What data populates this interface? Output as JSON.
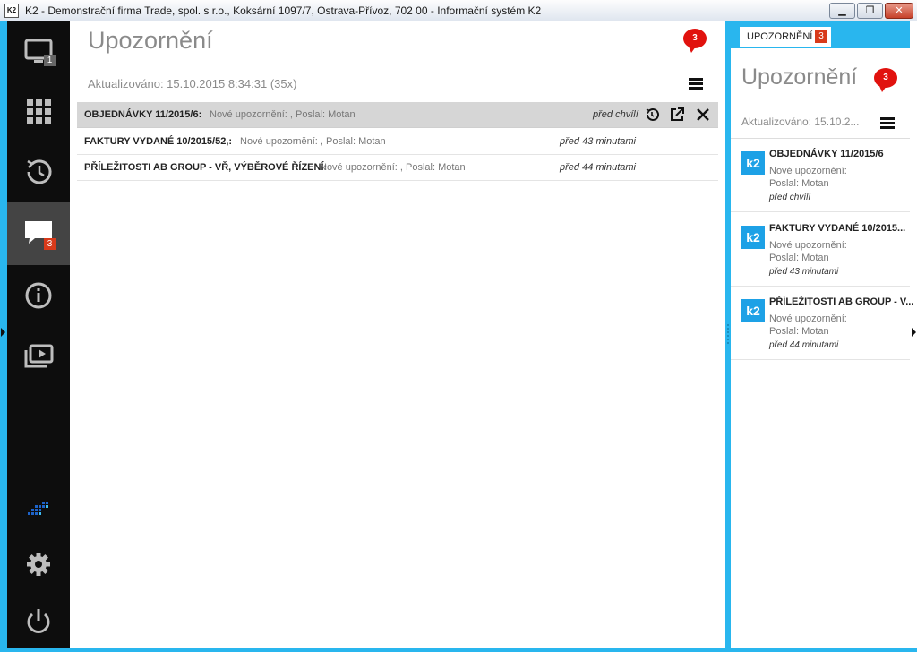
{
  "window": {
    "title": "K2 - Demonstrační firma Trade, spol. s r.o., Koksární 1097/7, Ostrava-Přívoz, 702 00 - Informační systém K2",
    "app_icon_label": "K2",
    "minimize": "▁",
    "maximize": "❐",
    "close": "✕"
  },
  "sidebar": {
    "items": [
      {
        "icon": "monitor-icon",
        "badge": "1"
      },
      {
        "icon": "apps-grid-icon",
        "badge": ""
      },
      {
        "icon": "history-icon",
        "badge": ""
      },
      {
        "icon": "notifications-icon",
        "badge": "3",
        "active": true
      },
      {
        "icon": "info-icon",
        "badge": ""
      },
      {
        "icon": "media-library-icon",
        "badge": ""
      }
    ],
    "bottom": [
      "k2-brand-icon",
      "settings-icon",
      "power-icon"
    ]
  },
  "main": {
    "title": "Upozornění",
    "badge": "3",
    "updated": "Aktualizováno: 15.10.2015 8:34:31 (35x)",
    "rows": [
      {
        "subject": "OBJEDNÁVKY 11/2015/6:",
        "desc": "Nové upozornění: , Poslal: Motan",
        "time": "před chvílí"
      },
      {
        "subject": "FAKTURY VYDANÉ 10/2015/52,:",
        "desc": "Nové upozornění: , Poslal: Motan",
        "time": "před 43 minutami"
      },
      {
        "subject": "PŘÍLEŽITOSTI AB GROUP - VŘ, VÝBĚROVÉ ŘÍZENÍ:",
        "desc": "Nové upozornění: , Poslal: Motan",
        "time": "před 44 minutami"
      }
    ]
  },
  "right_panel": {
    "tab_label": "UPOZORNĚNÍ",
    "tab_badge": "3",
    "title": "Upozornění",
    "badge": "3",
    "updated": "Aktualizováno: 15.10.2...",
    "logo_text": "k2",
    "cards": [
      {
        "title": "OBJEDNÁVKY 11/2015/6",
        "line1": "Nové upozornění:",
        "line2": "Poslal: Motan",
        "time": "před chvílí"
      },
      {
        "title": "FAKTURY VYDANÉ 10/2015...",
        "line1": "Nové upozornění:",
        "line2": "Poslal: Motan",
        "time": "před 43 minutami"
      },
      {
        "title": "PŘÍLEŽITOSTI AB GROUP - V...",
        "line1": "Nové upozornění:",
        "line2": "Poslal: Motan",
        "time": "před 44 minutami"
      }
    ]
  },
  "colors": {
    "accent": "#29b6ee",
    "badge_red": "#e1120e",
    "sidebar_bg": "#0d0d0d",
    "k2_blue": "#1da1e6"
  }
}
